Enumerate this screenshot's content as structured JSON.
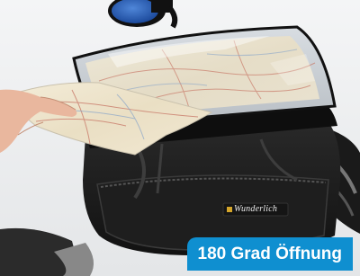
{
  "badge": {
    "text": "180 Grad Öffnung"
  },
  "brand": {
    "logo_text": "Wunderlich"
  },
  "colors": {
    "badge_background": "#0f8fd0",
    "badge_text": "#ffffff",
    "bag": "#1c1c1c",
    "mirror_blue": "#2a5fb8",
    "background": "#f2f3f4"
  }
}
